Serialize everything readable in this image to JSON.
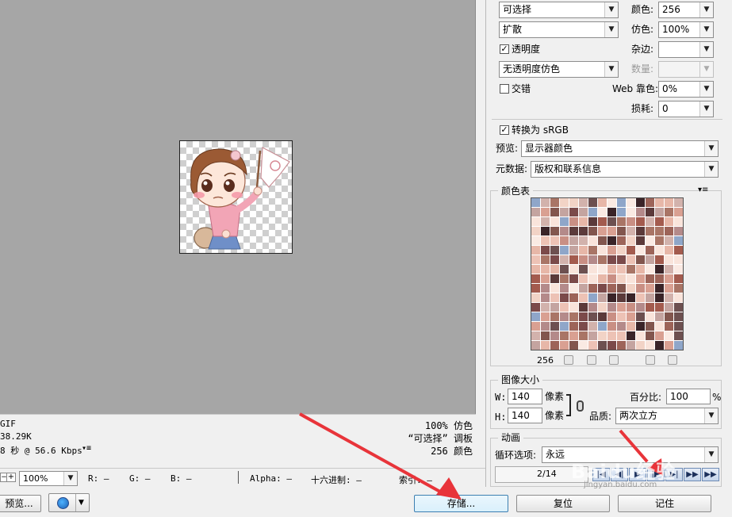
{
  "info": {
    "format": "GIF",
    "size": "38.29K",
    "time": "8 秒 @ 56.6 Kbps",
    "quality": "100% 仿色",
    "palette": "“可选择” 调板",
    "colors": "256 颜色"
  },
  "status": {
    "zoom": "100%",
    "r": "R: —",
    "g": "G: —",
    "b": "B: —",
    "alpha": "Alpha: —",
    "hex": "十六进制: —",
    "index": "索引: —"
  },
  "bottom": {
    "preview_label": "预览...",
    "save_label": "存储...",
    "reset_label": "复位",
    "remember_label": "记住"
  },
  "settings": {
    "reduction": "可选择",
    "dither_algo": "扩散",
    "transparency_label": "透明度",
    "transparency_dither": "无透明度仿色",
    "interlaced_label": "交错",
    "colors_label": "颜色:",
    "colors_value": "256",
    "dither_label": "仿色:",
    "dither_value": "100%",
    "matte_label": "杂边:",
    "matte_value": "",
    "amount_label": "数量:",
    "amount_value": "",
    "web_snap_label": "Web 靠色:",
    "web_snap_value": "0%",
    "lossy_label": "损耗:",
    "lossy_value": "0",
    "convert_srgb": "转换为 sRGB",
    "preview_label": "预览:",
    "preview_value": "显示器颜色",
    "metadata_label": "元数据:",
    "metadata_value": "版权和联系信息"
  },
  "color_table": {
    "title": "颜色表",
    "count": "256"
  },
  "image_size": {
    "title": "图像大小",
    "w_label": "W:",
    "w_value": "140",
    "h_label": "H:",
    "h_value": "140",
    "unit": "像素",
    "percent_label": "百分比:",
    "percent_value": "100",
    "percent_sign": "%",
    "quality_label": "品质:",
    "quality_value": "两次立方"
  },
  "animation": {
    "title": "动画",
    "loop_label": "循环选项:",
    "loop_value": "永远",
    "frame_counter": "2/14"
  },
  "watermark": {
    "text": "Baidu经验",
    "url": "jingyan.baidu.com"
  },
  "colors": {
    "canvas_bg": "#a6a6a6",
    "annotation_red": "#e8343a",
    "palette": [
      "#a97566",
      "#e7b7a8",
      "#5b3a3a",
      "#f2d3c6",
      "#c98f84",
      "#7b4a4a",
      "#f9e4db",
      "#b48a8a",
      "#8fa6c9",
      "#d9a092",
      "#6d5050",
      "#edc2b5",
      "#9d6459",
      "#c4a4a0",
      "#faeae3",
      "#3a2428",
      "#a35b4e",
      "#82564e",
      "#d2b2ac"
    ]
  }
}
